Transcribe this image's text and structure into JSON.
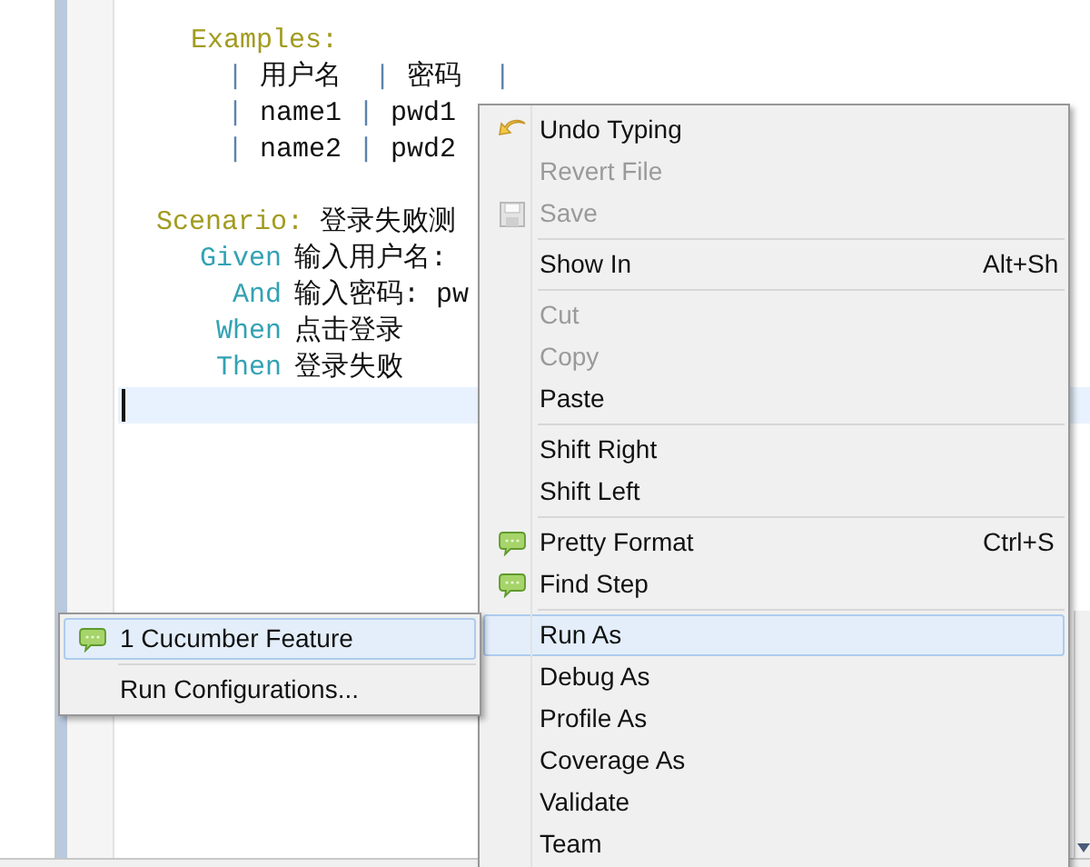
{
  "editor": {
    "lines": [
      {
        "kind": "section",
        "keyword": "Examples:"
      },
      {
        "kind": "table_row",
        "tokens": [
          {
            "kind": "pipe",
            "text": "|"
          },
          {
            "kind": "cell",
            "text": "用户名 "
          },
          {
            "kind": "pipe",
            "text": "|"
          },
          {
            "kind": "cell",
            "text": "密码 "
          },
          {
            "kind": "pipe",
            "text": "|"
          }
        ]
      },
      {
        "kind": "table_row",
        "tokens": [
          {
            "kind": "pipe",
            "text": "|"
          },
          {
            "kind": "cell",
            "text": "name1"
          },
          {
            "kind": "pipe",
            "text": "|"
          },
          {
            "kind": "cell",
            "text": "pwd1"
          }
        ]
      },
      {
        "kind": "table_row",
        "tokens": [
          {
            "kind": "pipe",
            "text": "|"
          },
          {
            "kind": "cell",
            "text": "name2"
          },
          {
            "kind": "pipe",
            "text": "|"
          },
          {
            "kind": "cell",
            "text": "pwd2"
          }
        ]
      },
      {
        "kind": "blank"
      },
      {
        "kind": "section",
        "keyword": "Scenario:",
        "text": "登录失败测"
      },
      {
        "kind": "step",
        "keyword": "Given",
        "text": "输入用户名:"
      },
      {
        "kind": "step",
        "keyword": "And",
        "text": "输入密码: pw"
      },
      {
        "kind": "step",
        "keyword": "When",
        "text": "点击登录"
      },
      {
        "kind": "step",
        "keyword": "Then",
        "text": "登录失败"
      },
      {
        "kind": "current"
      }
    ]
  },
  "context_menu": {
    "items": [
      {
        "kind": "undo",
        "label": "Undo Typing",
        "disabled": false,
        "selected": false
      },
      {
        "kind": "plain",
        "label": "Revert File",
        "disabled": true,
        "selected": false
      },
      {
        "kind": "save",
        "label": "Save",
        "disabled": true,
        "selected": false
      },
      {
        "kind": "separator"
      },
      {
        "kind": "plain",
        "label": "Show In",
        "shortcut": "Alt+Sh",
        "disabled": false,
        "selected": false
      },
      {
        "kind": "separator"
      },
      {
        "kind": "plain",
        "label": "Cut",
        "disabled": true,
        "selected": false
      },
      {
        "kind": "plain",
        "label": "Copy",
        "disabled": true,
        "selected": false
      },
      {
        "kind": "plain",
        "label": "Paste",
        "disabled": false,
        "selected": false
      },
      {
        "kind": "separator"
      },
      {
        "kind": "plain",
        "label": "Shift Right",
        "disabled": false,
        "selected": false
      },
      {
        "kind": "plain",
        "label": "Shift Left",
        "disabled": false,
        "selected": false
      },
      {
        "kind": "separator"
      },
      {
        "kind": "cucumber",
        "label": "Pretty Format",
        "shortcut": "Ctrl+S",
        "disabled": false,
        "selected": false
      },
      {
        "kind": "cucumber",
        "label": "Find Step",
        "disabled": false,
        "selected": false
      },
      {
        "kind": "separator"
      },
      {
        "kind": "plain",
        "label": "Run As",
        "disabled": false,
        "selected": true
      },
      {
        "kind": "plain",
        "label": "Debug As",
        "disabled": false,
        "selected": false
      },
      {
        "kind": "plain",
        "label": "Profile As",
        "disabled": false,
        "selected": false
      },
      {
        "kind": "plain",
        "label": "Coverage As",
        "disabled": false,
        "selected": false
      },
      {
        "kind": "plain",
        "label": "Validate",
        "disabled": false,
        "selected": false
      },
      {
        "kind": "plain",
        "label": "Team",
        "disabled": false,
        "selected": false
      }
    ]
  },
  "submenu": {
    "items": [
      {
        "kind": "cucumber",
        "label": "1 Cucumber Feature",
        "disabled": false,
        "selected": true
      },
      {
        "kind": "separator"
      },
      {
        "kind": "plain",
        "label": "Run Configurations...",
        "disabled": false,
        "selected": false
      }
    ]
  }
}
